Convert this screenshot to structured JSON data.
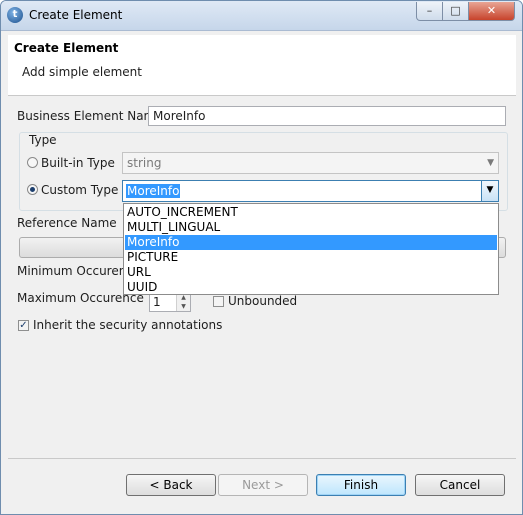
{
  "window": {
    "title": "Create Element",
    "app_icon": "app-logo-icon",
    "min_glyph": "–",
    "max_glyph": "□",
    "close_glyph": "✕"
  },
  "header": {
    "title": "Create Element",
    "subtitle": "Add simple element"
  },
  "form": {
    "business_element_name_label": "Business Element Name",
    "business_element_name_value": "MoreInfo",
    "type_group_label": "Type",
    "builtin_type_label": "Built-in Type",
    "builtin_type_value": "string",
    "custom_type_label": "Custom Type",
    "custom_type_value": "MoreInfo",
    "reference_name_label": "Reference Name",
    "min_occurence_label": "Minimum Occurence",
    "max_occurence_label": "Maximum Occurence",
    "max_occurence_value": "1",
    "unbounded_label": "Unbounded",
    "inherit_label": "Inherit the security annotations",
    "selected_type_radio": "custom",
    "unbounded_checked": false,
    "inherit_checked": true
  },
  "dropdown": {
    "items": [
      "AUTO_INCREMENT",
      "MULTI_LINGUAL",
      "MoreInfo",
      "PICTURE",
      "URL",
      "UUID"
    ],
    "selected": "MoreInfo"
  },
  "buttons": {
    "back": "< Back",
    "next": "Next >",
    "finish": "Finish",
    "cancel": "Cancel"
  },
  "colors": {
    "selection": "#3399ff",
    "accent_border": "#3c7fb1"
  }
}
